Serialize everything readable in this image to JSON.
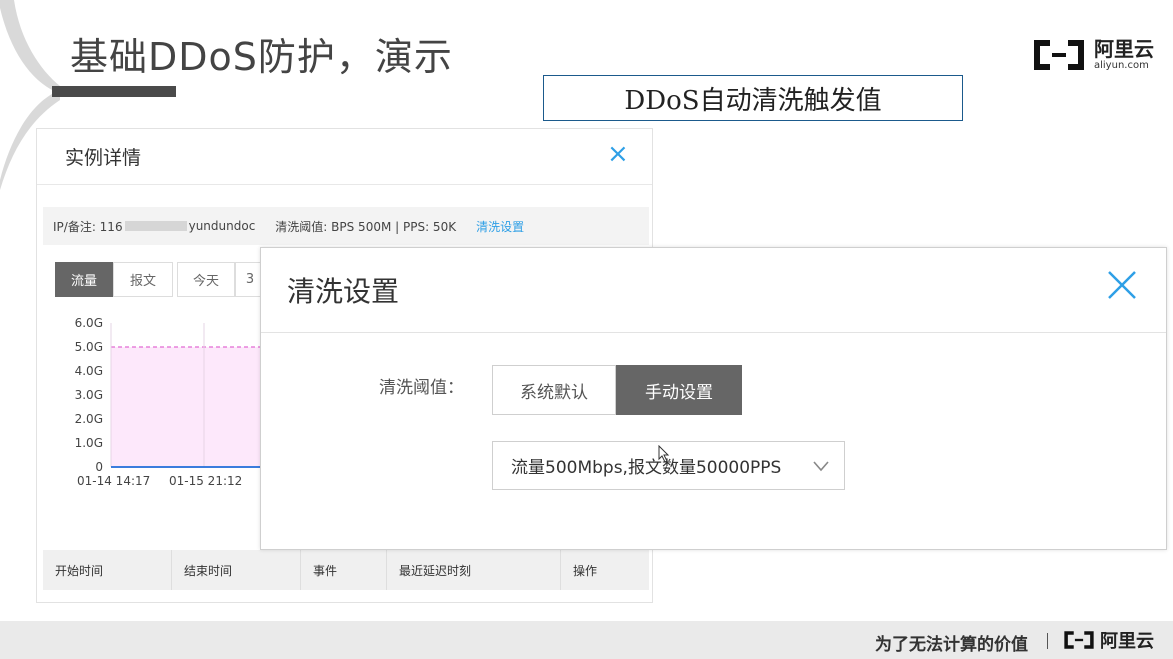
{
  "slide": {
    "title": "基础DDoS防护，演示",
    "callout": "DDoS自动清洗触发值",
    "brand_cn": "阿里云",
    "brand_en": "aliyun.com"
  },
  "panel": {
    "title": "实例详情",
    "close_glyph": "×",
    "info": {
      "ip_label": "IP/备注: 116",
      "ip_suffix": "yundundoc",
      "threshold_text": "清洗阈值: BPS 500M | PPS: 50K",
      "settings_link": "清洗设置"
    },
    "tabs": [
      "流量",
      "报文",
      "今天",
      "3"
    ],
    "chart": {
      "y_ticks": [
        "6.0G",
        "5.0G",
        "4.0G",
        "3.0G",
        "2.0G",
        "1.0G",
        "0"
      ],
      "x_ticks": [
        "01-14 14:17",
        "01-15 21:12"
      ]
    },
    "table_headers": [
      "开始时间",
      "结束时间",
      "事件",
      "最近延迟时刻",
      "操作"
    ]
  },
  "modal": {
    "title": "清洗设置",
    "field_label": "清洗阈值：",
    "options": [
      "系统默认",
      "手动设置"
    ],
    "selected_option": "手动设置",
    "select_value": "流量500Mbps,报文数量50000PPS"
  },
  "footer": {
    "slogan": "为了无法计算的价值",
    "brand_cn": "阿里云"
  },
  "colors": {
    "accent_blue": "#2e9fe6",
    "active_gray": "#666666",
    "chart_fill": "#fde8fb",
    "threshold_line": "#e26ad4",
    "baseline": "#3b7ddd"
  },
  "chart_data": {
    "type": "area",
    "x": [
      "01-14 14:17",
      "01-15 21:12"
    ],
    "ylim": [
      0,
      6
    ],
    "ylabel": "",
    "xlabel": "",
    "title": "",
    "series": [
      {
        "values": [
          0,
          0
        ]
      }
    ],
    "threshold": 5.0,
    "y_ticks": [
      "6.0G",
      "5.0G",
      "4.0G",
      "3.0G",
      "2.0G",
      "1.0G",
      "0"
    ],
    "grid": false
  }
}
